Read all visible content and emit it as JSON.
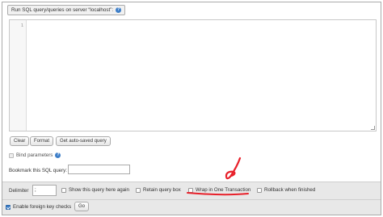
{
  "fieldset": {
    "legend": "Run SQL query/queries on server “localhost”:",
    "help_icon": "help-icon"
  },
  "editor": {
    "line_number": "1",
    "content": ""
  },
  "buttons": {
    "clear": "Clear",
    "format": "Format",
    "get_auto_saved": "Get auto-saved query",
    "go": "Go"
  },
  "bind_parameters": {
    "label": "Bind parameters",
    "checked": false,
    "help_icon": "help-icon"
  },
  "bookmark": {
    "label": "Bookmark this SQL query:",
    "value": ""
  },
  "options": {
    "delimiter_label": "Delimiter",
    "delimiter_value": ";",
    "show_query_here_again": "Show this query here again",
    "retain_query_box": "Retain query box",
    "wrap_in_one_transaction": "Wrap in One Transaction",
    "rollback_when_finished": "Rollback when finished"
  },
  "footer": {
    "enable_foreign_key_checks": "Enable foreign key checks",
    "enable_foreign_key_checks_checked": true
  },
  "colors": {
    "annotation_red": "#e8202a",
    "accent_blue": "#3d7ec8",
    "options_bar_bg": "#e8e8e8"
  }
}
